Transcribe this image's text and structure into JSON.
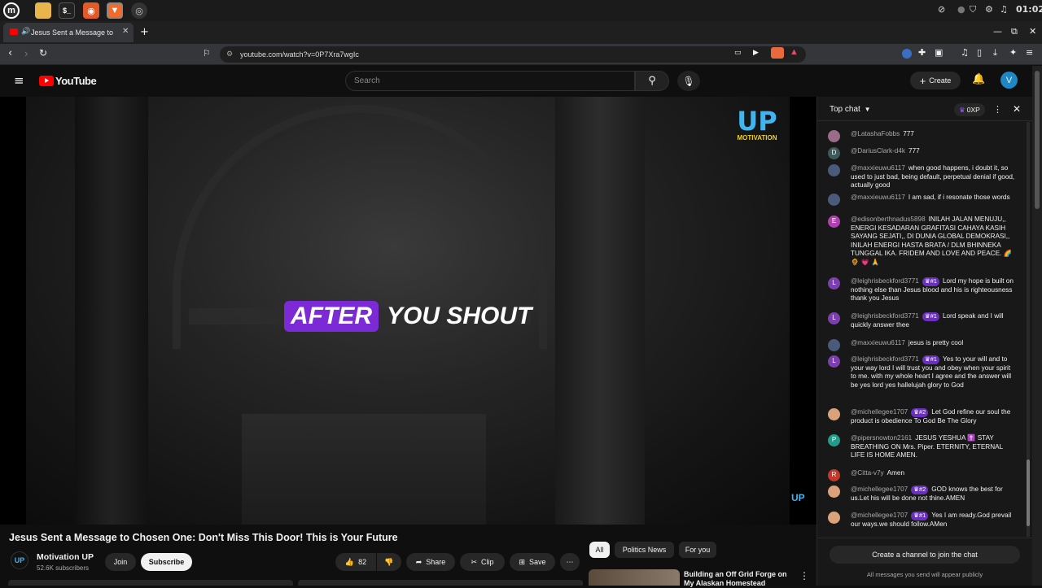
{
  "os": {
    "clock": "01:02"
  },
  "browser": {
    "tab_title": "Jesus Sent a Message to Ch",
    "url": "youtube.com/watch?v=0P7Xra7wgIc"
  },
  "youtube": {
    "logo_text": "YouTube",
    "search_placeholder": "Search",
    "create_label": "Create",
    "avatar_letter": "V"
  },
  "video": {
    "caption_highlight": "AFTER",
    "caption_rest": "YOU SHOUT",
    "watermark_top": "UP",
    "watermark_sub": "MOTIVATION",
    "watermark_corner": "UP",
    "title": "Jesus Sent a Message to Chosen One: Don't Miss This Door! This is Your Future",
    "channel_name": "Motivation UP",
    "channel_avatar": "UP",
    "subscribers": "52.6K subscribers",
    "join_label": "Join",
    "subscribe_label": "Subscribe",
    "likes": "82",
    "share_label": "Share",
    "clip_label": "Clip",
    "save_label": "Save"
  },
  "chips": [
    "All",
    "Politics News",
    "For you"
  ],
  "recommended": {
    "title_line1": "Building an Off Grid Forge on",
    "title_line2": "My Alaskan Homestead"
  },
  "chat": {
    "header_label": "Top chat",
    "points_label": "0XP",
    "messages": [
      {
        "author": "@LatashaFobbs",
        "text": "777",
        "avatar": "",
        "avatar_color": "#9b6b8a"
      },
      {
        "author": "@DariusClark-d4k",
        "text": "777",
        "avatar": "D",
        "avatar_color": "#3d5a5a"
      },
      {
        "author": "@maxxieuwu6117",
        "text": "when good happens, i doubt it, so used to just bad, being default, perpetual denial if good, actually good",
        "avatar": "",
        "avatar_color": "#4a5a7a"
      },
      {
        "author": "@maxxieuwu6117",
        "text": "I am sad, if i resonate those words",
        "avatar": "",
        "avatar_color": "#4a5a7a"
      },
      {
        "author": "@edisonberthnadus5898",
        "text": "INILAH JALAN MENUJU,, ENERGI KESADARAN GRAFITASI CAHAYA KASIH SAYANG SEJATI,, DI DUNIA GLOBAL DEMOKRASI,, INILAH ENERGI HASTA BRATA / DLM BHINNEKA TUNGGAL IKA. FRIDEM AND LOVE AND PEACE. 🌈 🌻 💗 🙏",
        "avatar": "E",
        "avatar_color": "#b03fb0"
      },
      {
        "author": "@leighrisbeckford3771",
        "badge": "#1",
        "text": "Lord my hope is built on nothing else than Jesus blood and his is righteousness thank you Jesus",
        "avatar": "L",
        "avatar_color": "#7b3fb0"
      },
      {
        "author": "@leighrisbeckford3771",
        "badge": "#1",
        "text": "Lord speak and I will quickly answer thee",
        "avatar": "L",
        "avatar_color": "#7b3fb0"
      },
      {
        "author": "@maxxieuwu6117",
        "text": "jesus is pretty cool",
        "avatar": "",
        "avatar_color": "#4a5a7a"
      },
      {
        "author": "@leighrisbeckford3771",
        "badge": "#1",
        "text": "Yes to your will and to your way lord I will trust you and obey when your spirit to me. with my whole heart I agree and the answer will be yes lord yes hallelujah glory to God",
        "avatar": "L",
        "avatar_color": "#7b3fb0"
      },
      {
        "author": "@michellegee1707",
        "badge": "#2",
        "text": "Let God refine our soul the product is obedience To God Be The Glory",
        "avatar": "",
        "avatar_color": "#d9a27a"
      },
      {
        "author": "@pipersnowton2161",
        "text": "JESUS YESHUA ✝️ STAY BREATHING ON Mrs. Piper. ETERNITY, ETERNAL LIFE IS HOME AMEN.",
        "avatar": "P",
        "avatar_color": "#1f9c8a"
      },
      {
        "author": "@Citta-v7y",
        "text": "Amen",
        "avatar": "R",
        "avatar_color": "#c0392b"
      },
      {
        "author": "@michellegee1707",
        "badge": "#2",
        "text": "GOD knows the best for us.Let his will be done not thine.AMEN",
        "avatar": "",
        "avatar_color": "#d9a27a"
      },
      {
        "author": "@michellegee1707",
        "badge": "#1",
        "text": "Yes I am ready.God prevail our ways.we should follow.AMen",
        "avatar": "",
        "avatar_color": "#d9a27a"
      }
    ],
    "create_channel_label": "Create a channel to join the chat",
    "footer_note": "All messages you send will appear publicly"
  }
}
